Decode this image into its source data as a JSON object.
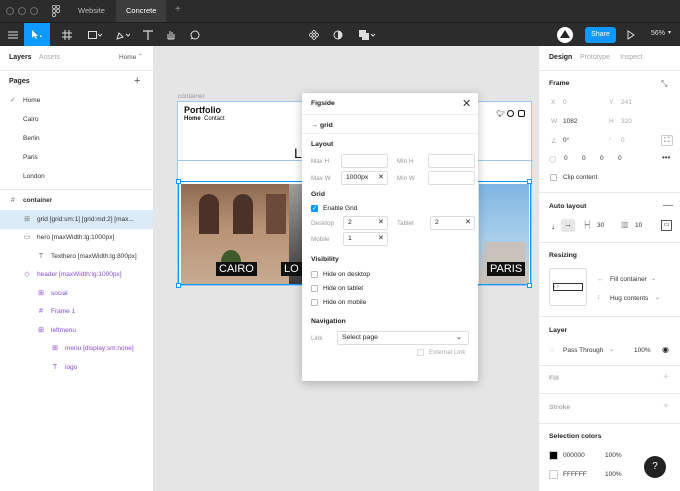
{
  "tabs": {
    "file_tab": "Website",
    "active_tab": "Concrete",
    "add": "+"
  },
  "toolbar": {
    "share_label": "Share",
    "zoom": "56%"
  },
  "left_panel": {
    "tab_layers": "Layers",
    "tab_assets": "Assets",
    "page_selector": "Home",
    "pages_title": "Pages",
    "pages": [
      "Home",
      "Cairo",
      "Berlin",
      "Paris",
      "London"
    ],
    "layers": [
      {
        "name": "container",
        "indent": 0,
        "icon": "#",
        "kind": "frame"
      },
      {
        "name": "grid [grid:sm:1] [grid:md:2] [max...",
        "indent": 1,
        "icon": "⊞",
        "kind": "frame"
      },
      {
        "name": "hero [maxWidth:lg:1000px]",
        "indent": 1,
        "icon": "▭",
        "kind": "frame"
      },
      {
        "name": "Texthero [maxWidth:lg:800px]",
        "indent": 2,
        "icon": "T",
        "kind": "text"
      },
      {
        "name": "header [maxWidth:lg:1000px]",
        "indent": 1,
        "icon": "◇",
        "kind": "component"
      },
      {
        "name": "social",
        "indent": 2,
        "icon": "⊞",
        "kind": "component"
      },
      {
        "name": "Frame 1",
        "indent": 2,
        "icon": "#",
        "kind": "component"
      },
      {
        "name": "leftmenu",
        "indent": 2,
        "icon": "⊞",
        "kind": "component"
      },
      {
        "name": "menu [display:sm:none]",
        "indent": 3,
        "icon": "⊞",
        "kind": "component"
      },
      {
        "name": "logo",
        "indent": 3,
        "icon": "T",
        "kind": "component"
      }
    ]
  },
  "canvas": {
    "container_label": "container",
    "logo": "Portfolio",
    "nav": [
      "Home",
      "Contact"
    ],
    "hero_letter": "L",
    "cities": [
      "CAIRO",
      "LO",
      "PARIS"
    ]
  },
  "plugin": {
    "title": "Figside",
    "selection": "grid",
    "layout_title": "Layout",
    "max_h_label": "Max H",
    "min_h_label": "Min H",
    "max_w_label": "Max W",
    "max_w_value": "1000px",
    "min_w_label": "Min W",
    "grid_title": "Grid",
    "enable_grid": "Enable Grid",
    "desktop_label": "Desktop",
    "desktop_value": "2",
    "tablet_label": "Tablet",
    "tablet_value": "2",
    "mobile_label": "Mobile",
    "mobile_value": "1",
    "visibility_title": "Visibility",
    "hide_desktop": "Hide on desktop",
    "hide_tablet": "Hide on tablet",
    "hide_mobile": "Hide on mobile",
    "navigation_title": "Navigation",
    "link_label": "Link",
    "link_select": "Select page",
    "external_link": "External Link"
  },
  "right_panel": {
    "tab_design": "Design",
    "tab_prototype": "Prototype",
    "tab_inspect": "Inspect",
    "frame_title": "Frame",
    "x_label": "X",
    "x_value": "0",
    "y_label": "Y",
    "y_value": "241",
    "w_label": "W",
    "w_value": "1082",
    "h_label": "H",
    "h_value": "320",
    "rotation": "0°",
    "radius": "0",
    "corners": [
      "0",
      "0",
      "0",
      "0"
    ],
    "clip_content": "Clip content",
    "auto_layout_title": "Auto layout",
    "spacing": "30",
    "padding": "10",
    "resizing_title": "Resizing",
    "fill_container": "Fill container",
    "hug_contents": "Hug contents",
    "layer_title": "Layer",
    "blend": "Pass Through",
    "opacity": "100%",
    "fill_title": "Fill",
    "stroke_title": "Stroke",
    "selection_colors_title": "Selection colors",
    "colors": [
      {
        "hex": "000000",
        "opacity": "100%",
        "swatch": "#000000"
      },
      {
        "hex": "FFFFFF",
        "opacity": "100%",
        "swatch": "#FFFFFF"
      }
    ]
  },
  "help_label": "?"
}
